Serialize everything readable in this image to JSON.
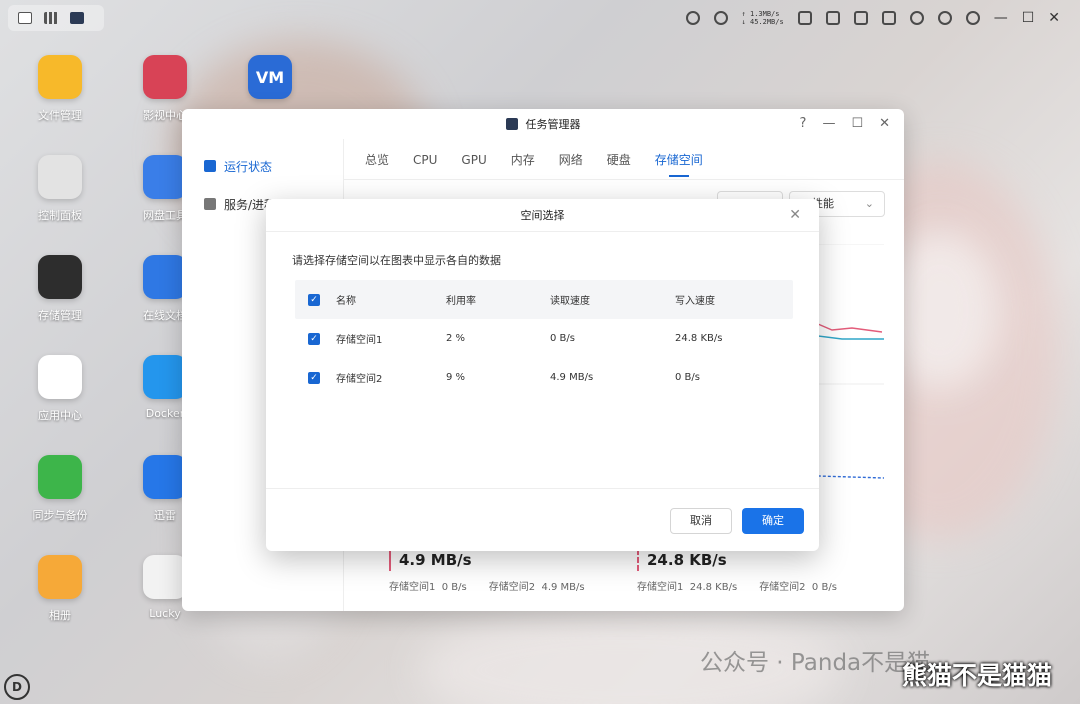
{
  "desktop": {
    "icons": [
      {
        "label": "文件管理",
        "color": "#f7b92a",
        "glyph": "folder-icon"
      },
      {
        "label": "影视中心",
        "color": "#d84356",
        "glyph": "film-icon"
      },
      {
        "label": "",
        "color": "#2a6bd6",
        "glyph": "vm-icon",
        "text": "VM"
      },
      {
        "label": "控制面板",
        "color": "#e3e3e3",
        "glyph": "sliders-icon"
      },
      {
        "label": "网盘工具",
        "color": "#3a7ee8",
        "glyph": "cloud-drive-icon"
      },
      {
        "label": "存储管理",
        "color": "#2d2d2d",
        "glyph": "storage-icon"
      },
      {
        "label": "在线文档",
        "color": "#2f78e4",
        "glyph": "doc-icon"
      },
      {
        "label": "应用中心",
        "color": "#ffffff",
        "glyph": "app-center-icon"
      },
      {
        "label": "Docker",
        "color": "#2496ed",
        "glyph": "docker-icon"
      },
      {
        "label": "同步与备份",
        "color": "#3db54a",
        "glyph": "sync-icon"
      },
      {
        "label": "迅雷",
        "color": "#2677e8",
        "glyph": "thunder-icon"
      },
      {
        "label": "相册",
        "color": "#f6a938",
        "glyph": "album-icon"
      },
      {
        "label": "Lucky",
        "color": "#f2f2f2",
        "glyph": "lucky-icon"
      }
    ]
  },
  "topbar": {
    "net_up": "↑ 1.3MB/s",
    "net_down": "↓ 45.2MB/s",
    "cpu_label": "CPU",
    "ram_label": "RAM"
  },
  "task_manager": {
    "title": "任务管理器",
    "help": "?",
    "sidebar": [
      {
        "label": "运行状态",
        "active": true
      },
      {
        "label": "服务/进程",
        "active": false
      }
    ],
    "tabs": [
      {
        "label": "总览"
      },
      {
        "label": "CPU"
      },
      {
        "label": "GPU"
      },
      {
        "label": "内存"
      },
      {
        "label": "网络"
      },
      {
        "label": "硬盘"
      },
      {
        "label": "存储空间",
        "active": true
      }
    ],
    "perf_select": "性能",
    "read": {
      "value": "4.9 MB/s",
      "s1_label": "存储空间1",
      "s1_value": "0 B/s",
      "s2_label": "存储空间2",
      "s2_value": "4.9 MB/s"
    },
    "write": {
      "value": "24.8 KB/s",
      "s1_label": "存储空间1",
      "s1_value": "24.8 KB/s",
      "s2_label": "存储空间2",
      "s2_value": "0 B/s"
    }
  },
  "dialog": {
    "title": "空间选择",
    "description": "请选择存储空间以在图表中显示各自的数据",
    "columns": [
      "名称",
      "利用率",
      "读取速度",
      "写入速度"
    ],
    "rows": [
      {
        "name": "存储空间1",
        "usage": "2 %",
        "read": "0 B/s",
        "write": "24.8 KB/s",
        "checked": true
      },
      {
        "name": "存储空间2",
        "usage": "9 %",
        "read": "4.9 MB/s",
        "write": "0 B/s",
        "checked": true
      }
    ],
    "cancel": "取消",
    "ok": "确定"
  },
  "watermark": {
    "line1": "公众号 · Panda不是猫",
    "line2": "熊猫不是猫猫"
  }
}
